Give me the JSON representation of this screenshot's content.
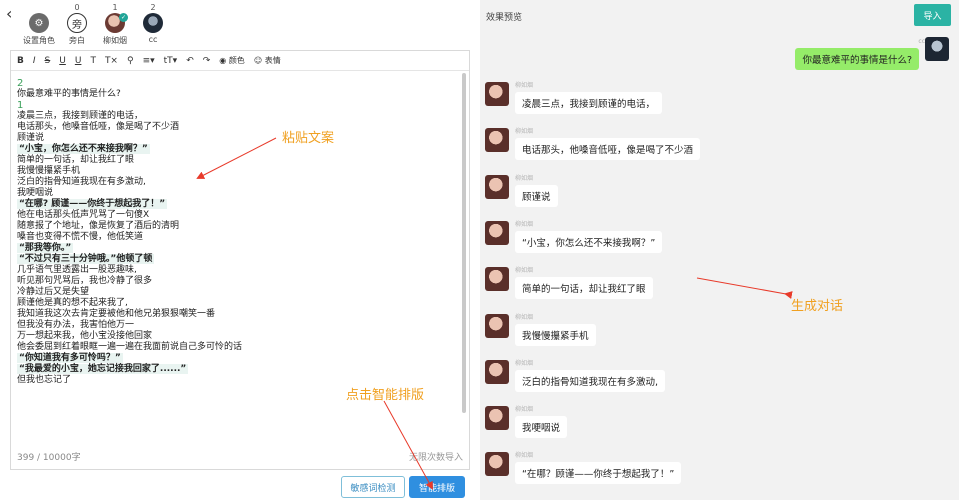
{
  "nav": {
    "back_icon": "chevron-left-icon"
  },
  "roles": [
    {
      "count": "",
      "label": "设置角色",
      "icon": "user-settings-icon"
    },
    {
      "count": "0",
      "label": "旁白",
      "avatar_text": "旁"
    },
    {
      "count": "1",
      "label": "柳如烟",
      "icon": "avatar-female"
    },
    {
      "count": "2",
      "label": "cc",
      "icon": "avatar-dark"
    }
  ],
  "toolbar": {
    "color_label": "颜色",
    "emoji_label": "表情"
  },
  "editor": {
    "lines": [
      {
        "text": "2",
        "type": "num"
      },
      {
        "text": "你最意难平的事情是什么?",
        "type": "plain"
      },
      {
        "text": "1",
        "type": "num"
      },
      {
        "text": "凌晨三点，我接到顾谨的电话，",
        "type": "plain"
      },
      {
        "text": "电话那头，他嗓音低哑，像是喝了不少酒",
        "type": "plain"
      },
      {
        "text": "顾谨说",
        "type": "plain"
      },
      {
        "text": "“小宝，你怎么还不来接我啊？”",
        "type": "hl"
      },
      {
        "text": "简单的一句话，却让我红了眼",
        "type": "plain"
      },
      {
        "text": "我慢慢攥紧手机",
        "type": "plain"
      },
      {
        "text": "泛白的指骨知道我现在有多激动,",
        "type": "plain"
      },
      {
        "text": "我哽咽说",
        "type": "plain"
      },
      {
        "text": "“在哪? 顾谨——你终于想起我了！”",
        "type": "hl"
      },
      {
        "text": "他在电话那头低声咒骂了一句傻X",
        "type": "plain"
      },
      {
        "text": "随意报了个地址，像是恢复了酒后的清明",
        "type": "plain"
      },
      {
        "text": "嗓音也变得不慌不慢，他低笑道",
        "type": "plain"
      },
      {
        "text": "“那我等你。”",
        "type": "hl"
      },
      {
        "text": "“不过只有三十分钟哦。”他顿了顿",
        "type": "hl"
      },
      {
        "text": "几乎语气里透露出一股恶趣味,",
        "type": "plain"
      },
      {
        "text": "听见那句咒骂后，我也冷静了很多",
        "type": "plain"
      },
      {
        "text": "冷静过后又是失望",
        "type": "plain"
      },
      {
        "text": "顾谨他是真的想不起来我了,",
        "type": "plain"
      },
      {
        "text": "我知道我这次去肯定要被他和他兄弟狠狠嘲笑一番",
        "type": "plain"
      },
      {
        "text": "但我没有办法，我害怕他万一",
        "type": "plain"
      },
      {
        "text": "万一想起来我，他小宝没接他回家",
        "type": "plain"
      },
      {
        "text": "他会委屈到红着眼眶一遍一遍在我面前说自己多可怜的话",
        "type": "plain"
      },
      {
        "text": "“你知道我有多可怜吗？”",
        "type": "hl"
      },
      {
        "text": "“我最爱的小宝，她忘记接我回家了......”",
        "type": "hl"
      },
      {
        "text": "但我也忘记了",
        "type": "plain"
      }
    ],
    "char_count": "399 / 10000字",
    "limit_text": "无限次数导入"
  },
  "buttons": {
    "check": "敏感词检测",
    "smart": "智能排版"
  },
  "annotations": {
    "paste": "粘贴文案",
    "generate": "生成对话",
    "click_smart": "点击智能排版",
    "color": "#f0a020"
  },
  "preview": {
    "title": "效果预览",
    "import_label": "导入",
    "me_name": "cc",
    "me_message": "你最意难平的事情是什么?",
    "other_name": "柳如烟",
    "messages": [
      "凌晨三点，我接到顾谨的电话，",
      "电话那头，他嗓音低哑，像是喝了不少酒",
      "顾谨说",
      "“小宝，你怎么还不来接我啊？”",
      "简单的一句话，却让我红了眼",
      "我慢慢攥紧手机",
      "泛白的指骨知道我现在有多激动,",
      "我哽咽说",
      "“在哪？顾谨——你终于想起我了！”"
    ]
  }
}
